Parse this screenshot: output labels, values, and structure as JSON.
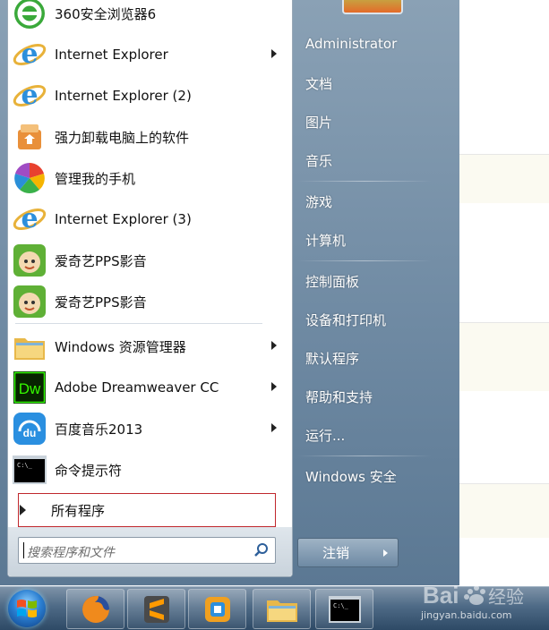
{
  "start_menu": {
    "programs": [
      {
        "label": "360安全浏览器6",
        "icon": "browser-360-icon",
        "arrow": false
      },
      {
        "label": "Internet Explorer",
        "icon": "internet-explorer-icon",
        "arrow": true
      },
      {
        "label": "Internet Explorer (2)",
        "icon": "internet-explorer-icon",
        "arrow": false
      },
      {
        "label": "强力卸载电脑上的软件",
        "icon": "uninstaller-icon",
        "arrow": false
      },
      {
        "label": "管理我的手机",
        "icon": "phone-manager-icon",
        "arrow": false
      },
      {
        "label": "Internet Explorer (3)",
        "icon": "internet-explorer-icon",
        "arrow": false
      },
      {
        "label": "爱奇艺PPS影音",
        "icon": "iqiyi-pps-icon",
        "arrow": false
      },
      {
        "label": "爱奇艺PPS影音",
        "icon": "iqiyi-pps-icon",
        "arrow": false
      },
      {
        "label": "Windows 资源管理器",
        "icon": "windows-explorer-icon",
        "arrow": true
      },
      {
        "label": "Adobe Dreamweaver CC",
        "icon": "dreamweaver-icon",
        "arrow": true
      },
      {
        "label": "百度音乐2013",
        "icon": "baidu-music-icon",
        "arrow": true
      },
      {
        "label": "命令提示符",
        "icon": "command-prompt-icon",
        "arrow": false
      }
    ],
    "all_programs": "所有程序",
    "search_placeholder": "搜索程序和文件",
    "right_items": [
      "Administrator",
      "文档",
      "图片",
      "音乐",
      "游戏",
      "计算机",
      "控制面板",
      "设备和打印机",
      "默认程序",
      "帮助和支持",
      "运行...",
      "Windows 安全"
    ],
    "shutdown_label": "注销"
  },
  "taskbar": {
    "items": [
      "firefox-icon",
      "sublime-text-icon",
      "app-icon",
      "file-explorer-icon",
      "command-prompt-icon"
    ]
  },
  "watermark": {
    "text": "jingyan.baidu.com",
    "logo": "Baidu经验"
  },
  "colors": {
    "right_pane": "#6f8aa3",
    "taskbar": "#2e4a66",
    "highlight_border": "#c0272d"
  }
}
